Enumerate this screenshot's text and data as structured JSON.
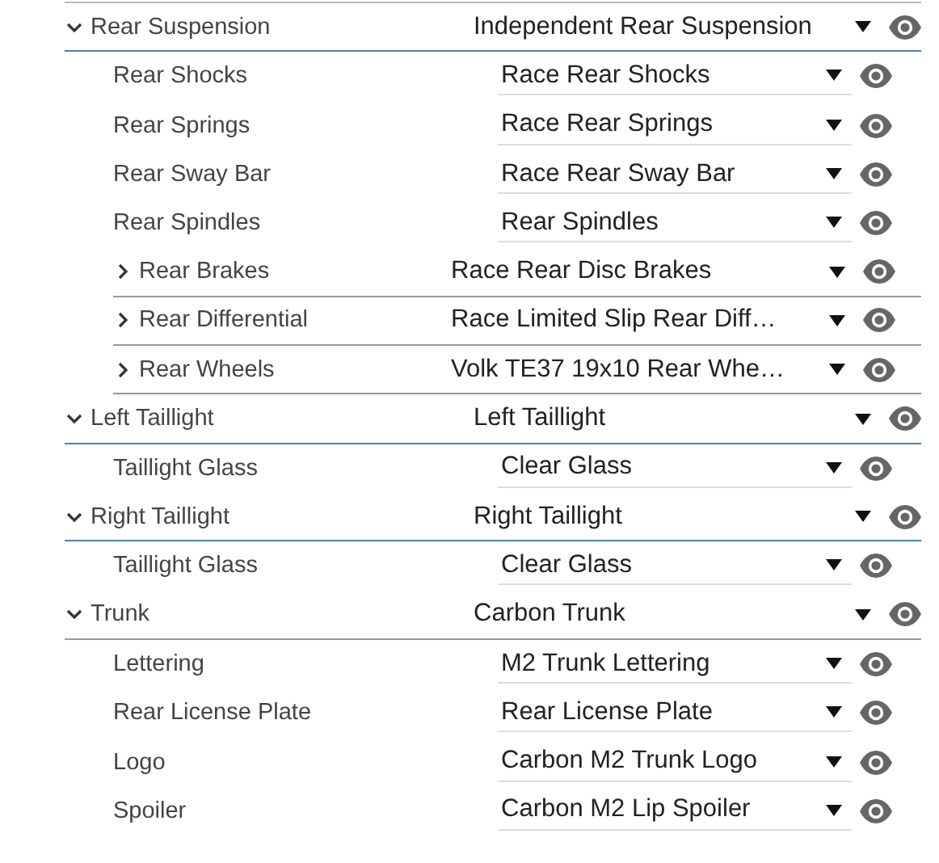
{
  "rows": [
    {
      "kind": "group",
      "label": "Rear Suspension",
      "value": "Independent Rear Suspension",
      "expanded": true,
      "selected": true,
      "children": [
        {
          "kind": "leaf",
          "label": "Rear Shocks",
          "value": "Race Rear Shocks",
          "selected": false
        },
        {
          "kind": "leaf",
          "label": "Rear Springs",
          "value": "Race Rear Springs",
          "selected": false
        },
        {
          "kind": "leaf",
          "label": "Rear Sway Bar",
          "value": "Race Rear Sway Bar",
          "selected": false
        },
        {
          "kind": "leaf",
          "label": "Rear Spindles",
          "value": "Rear Spindles",
          "selected": false
        },
        {
          "kind": "group",
          "label": "Rear Brakes",
          "value": "Race Rear Disc Brakes",
          "expanded": false,
          "selected": false
        },
        {
          "kind": "group",
          "label": "Rear Differential",
          "value": "Race Limited Slip Rear Diff…",
          "expanded": false,
          "selected": false
        },
        {
          "kind": "group",
          "label": "Rear Wheels",
          "value": "Volk TE37 19x10 Rear Whe…",
          "expanded": false,
          "selected": false
        }
      ]
    },
    {
      "kind": "group",
      "label": "Left Taillight",
      "value": "Left Taillight",
      "expanded": true,
      "selected": true,
      "children": [
        {
          "kind": "leaf",
          "label": "Taillight Glass",
          "value": "Clear Glass",
          "selected": false
        }
      ]
    },
    {
      "kind": "group",
      "label": "Right Taillight",
      "value": "Right Taillight",
      "expanded": true,
      "selected": true,
      "children": [
        {
          "kind": "leaf",
          "label": "Taillight Glass",
          "value": "Clear Glass",
          "selected": false
        }
      ]
    },
    {
      "kind": "group",
      "label": "Trunk",
      "value": "Carbon Trunk",
      "expanded": true,
      "selected": false,
      "children": [
        {
          "kind": "leaf",
          "label": "Lettering",
          "value": "M2 Trunk Lettering",
          "selected": false
        },
        {
          "kind": "leaf",
          "label": "Rear License Plate",
          "value": "Rear License Plate",
          "selected": false
        },
        {
          "kind": "leaf",
          "label": "Logo",
          "value": "Carbon M2 Trunk Logo",
          "selected": false
        },
        {
          "kind": "leaf",
          "label": "Spoiler",
          "value": "Carbon M2 Lip Spoiler",
          "selected": false
        }
      ]
    }
  ]
}
